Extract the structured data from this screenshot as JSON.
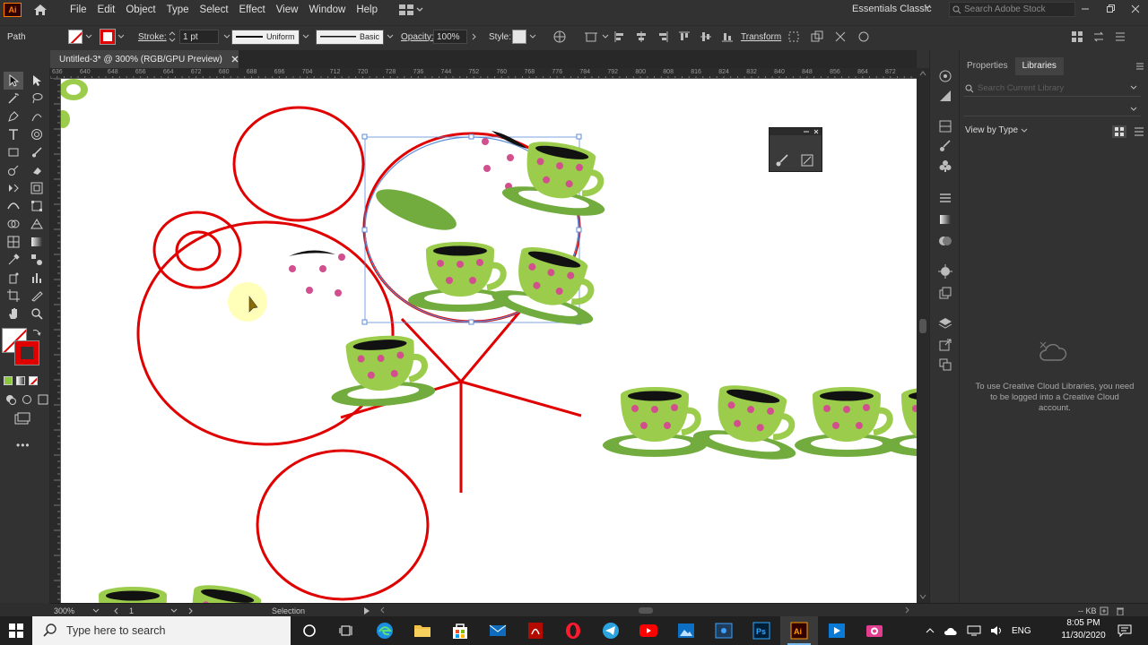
{
  "app": {
    "logo_text": "Ai",
    "menu": [
      "File",
      "Edit",
      "Object",
      "Type",
      "Select",
      "Effect",
      "View",
      "Window",
      "Help"
    ],
    "workspace": "Essentials Classic",
    "stock_search_placeholder": "Search Adobe Stock"
  },
  "control_bar": {
    "selection_type": "Path",
    "stroke_label": "Stroke:",
    "stroke_weight": "1 pt",
    "profile": "Uniform",
    "brush": "Basic",
    "opacity_label": "Opacity:",
    "opacity_value": "100%",
    "style_label": "Style:",
    "transform_label": "Transform",
    "stroke_color": "#e00000"
  },
  "document": {
    "tab_title": "Untitled-3* @ 300% (RGB/GPU Preview)",
    "ruler_ticks": [
      "636",
      "640",
      "648",
      "656",
      "664",
      "672",
      "680",
      "688",
      "696",
      "704",
      "712",
      "720",
      "728",
      "736",
      "744",
      "752",
      "760",
      "768",
      "776",
      "784",
      "792",
      "800",
      "808",
      "816",
      "824",
      "832",
      "840",
      "848",
      "856",
      "864",
      "872"
    ]
  },
  "right_panel": {
    "tabs": [
      "Properties",
      "Libraries"
    ],
    "active_tab": "Libraries",
    "search_placeholder": "Search Current Library",
    "view_by": "View by Type",
    "message": "To use Creative Cloud Libraries, you need to be logged into a Creative Cloud account."
  },
  "status_bar": {
    "zoom": "300%",
    "artboard": "1",
    "tool": "Selection",
    "kb": "-- KB"
  },
  "taskbar": {
    "search_placeholder": "Type here to search",
    "lang": "ENG",
    "time": "8:05 PM",
    "date": "11/30/2020"
  },
  "colors": {
    "stroke_red": "#e00000",
    "cup_green": "#9bcc4c",
    "saucer_green": "#72ab3e",
    "dot_pink": "#d24f8e",
    "selection_blue": "#5c8ed8"
  }
}
